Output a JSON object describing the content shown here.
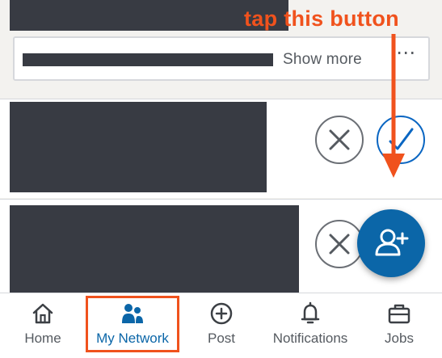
{
  "annotation": {
    "text": "tap this button",
    "color": "#f0521d"
  },
  "show_more_card": {
    "label": "Show more",
    "overflow_icon": "more-horizontal-icon"
  },
  "invitations": [
    {
      "decline_icon": "close-icon",
      "accept_icon": "check-icon"
    },
    {
      "decline_icon": "close-icon"
    }
  ],
  "fab": {
    "icon": "add-person-icon",
    "color": "#0b66a8"
  },
  "bottom_nav": {
    "items": [
      {
        "label": "Home",
        "icon": "home-icon",
        "active": false
      },
      {
        "label": "My Network",
        "icon": "my-network-icon",
        "active": true
      },
      {
        "label": "Post",
        "icon": "post-plus-icon",
        "active": false
      },
      {
        "label": "Notifications",
        "icon": "bell-icon",
        "active": false
      },
      {
        "label": "Jobs",
        "icon": "briefcase-icon",
        "active": false
      }
    ],
    "active_color": "#0b66a8"
  }
}
